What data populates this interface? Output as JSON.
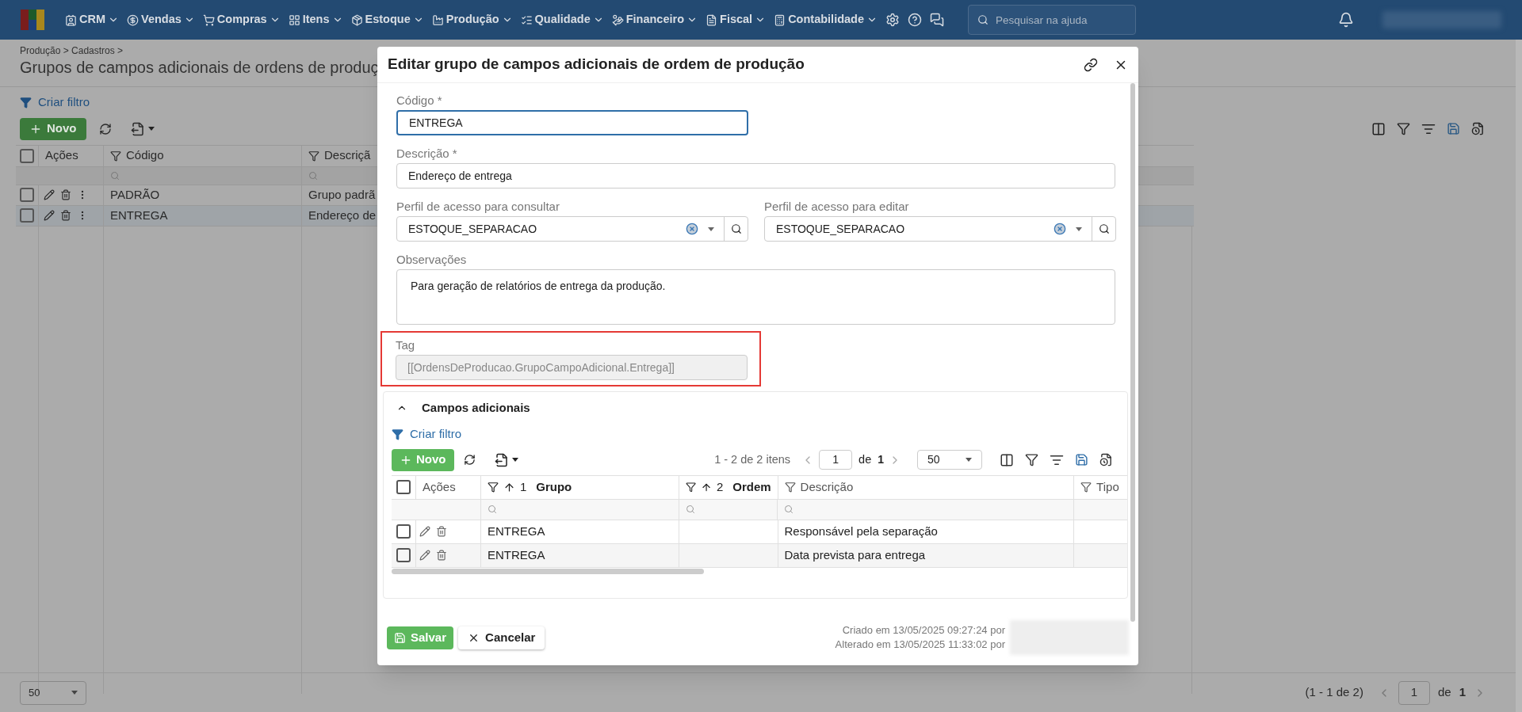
{
  "nav": {
    "menus": [
      {
        "label": "CRM"
      },
      {
        "label": "Vendas"
      },
      {
        "label": "Compras"
      },
      {
        "label": "Itens"
      },
      {
        "label": "Estoque"
      },
      {
        "label": "Produção"
      },
      {
        "label": "Qualidade"
      },
      {
        "label": "Financeiro"
      },
      {
        "label": "Fiscal"
      },
      {
        "label": "Contabilidade"
      }
    ],
    "search": {
      "placeholder": "Pesquisar na ajuda"
    }
  },
  "page": {
    "breadcrumb": "Produção > Cadastros >",
    "title": "Grupos de campos adicionais de ordens de produç",
    "filter_link": "Criar filtro",
    "new_button": "Novo",
    "table": {
      "all_checked": false,
      "columns": [
        {
          "label": "Ações"
        },
        {
          "label": "Código"
        },
        {
          "label": "Descriçã"
        }
      ],
      "rows": [
        {
          "codigo": "PADRÃO",
          "descricao": "Grupo padrã",
          "selected": false,
          "checked": false
        },
        {
          "codigo": "ENTREGA",
          "descricao": "Endereço de",
          "selected": true,
          "checked": false
        }
      ]
    },
    "page_size": "50",
    "range": "(1 - 1 de 2)",
    "page": "1",
    "of": "de",
    "total": "1"
  },
  "dialog": {
    "title": "Editar grupo de campos adicionais de ordem de produção",
    "codigo": {
      "label": "Código *",
      "value": "ENTREGA",
      "focused": true
    },
    "descricao": {
      "label": "Descrição *",
      "value": "Endereço de entrega",
      "focused": false
    },
    "perfis": [
      {
        "label": "Perfil de acesso para consultar",
        "value": "ESTOQUE_SEPARACAO"
      },
      {
        "label": "Perfil de acesso para editar",
        "value": "ESTOQUE_SEPARACAO"
      }
    ],
    "observacoes": {
      "label": "Observações",
      "value": "Para geração de relatórios de entrega da produção."
    },
    "tag": {
      "label": "Tag",
      "value": "[[OrdensDeProducao.GrupoCampoAdicional.Entrega]]",
      "disabled": true,
      "highlighted": true
    },
    "section": {
      "title": "Campos adicionais",
      "expanded": true,
      "filter_link": "Criar filtro",
      "new_button": "Novo",
      "range": "1 - 2 de 2 itens",
      "page": "1",
      "of": "de",
      "total": "1",
      "page_size": "50",
      "all_checked": false,
      "columns": [
        {
          "label": "Ações"
        },
        {
          "label": "Grupo",
          "sort": "1"
        },
        {
          "label": "Ordem",
          "sort": "2"
        },
        {
          "label": "Descrição"
        },
        {
          "label": "Tipo"
        }
      ],
      "rows": [
        {
          "grupo": "ENTREGA",
          "ordem": "",
          "descricao": "Responsável pela separação",
          "checked": false
        },
        {
          "grupo": "ENTREGA",
          "ordem": "",
          "descricao": "Data prevista para entrega",
          "checked": false
        }
      ]
    },
    "save": "Salvar",
    "cancel": "Cancelar",
    "created": "Criado em 13/05/2025 09:27:24 por",
    "altered": "Alterado em 13/05/2025 11:33:02 por"
  }
}
